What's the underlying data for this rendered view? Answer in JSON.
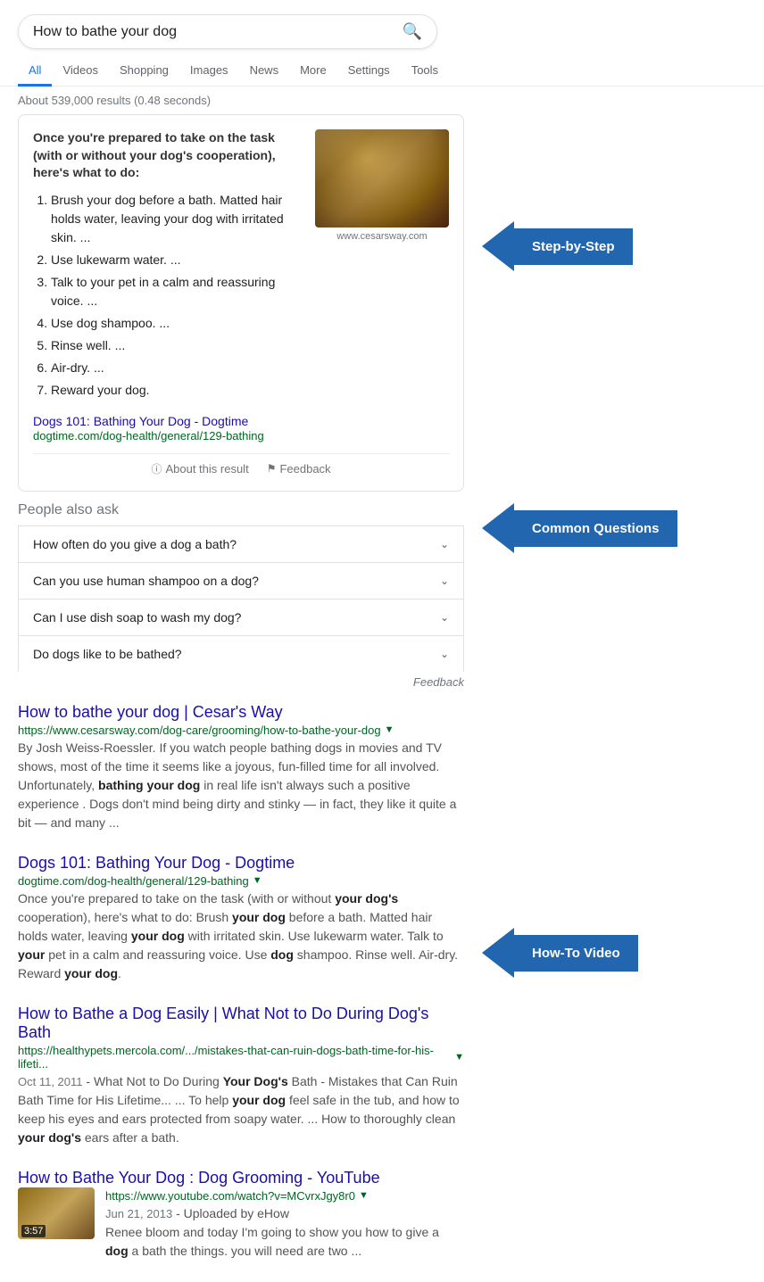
{
  "search": {
    "query": "How to bathe your dog",
    "placeholder": "How to bathe your dog",
    "results_meta": "About 539,000 results (0.48 seconds)"
  },
  "nav": {
    "tabs": [
      {
        "label": "All",
        "active": true
      },
      {
        "label": "Videos",
        "active": false
      },
      {
        "label": "Shopping",
        "active": false
      },
      {
        "label": "Images",
        "active": false
      },
      {
        "label": "News",
        "active": false
      },
      {
        "label": "More",
        "active": false
      },
      {
        "label": "Settings",
        "active": false
      },
      {
        "label": "Tools",
        "active": false
      }
    ]
  },
  "featured_snippet": {
    "title": "Once you're prepared to take on the task (with or without your dog's cooperation), here's what to do:",
    "steps": [
      "Brush your dog before a bath. Matted hair holds water, leaving your dog with irritated skin. ...",
      "Use lukewarm water. ...",
      "Talk to your pet in a calm and reassuring voice. ...",
      "Use dog shampoo. ...",
      "Rinse well. ...",
      "Air-dry. ...",
      "Reward your dog."
    ],
    "image_caption": "www.cesarsway.com",
    "source_title": "Dogs 101: Bathing Your Dog - Dogtime",
    "source_url": "dogtime.com/dog-health/general/129-bathing",
    "about_label": "About this result",
    "feedback_label": "Feedback"
  },
  "paa": {
    "title": "People also ask",
    "questions": [
      "How often do you give a dog a bath?",
      "Can you use human shampoo on a dog?",
      "Can I use dish soap to wash my dog?",
      "Do dogs like to be bathed?"
    ],
    "feedback_label": "Feedback"
  },
  "results": [
    {
      "title": "How to bathe your dog | Cesar's Way",
      "url": "https://www.cesarsway.com/dog-care/grooming/how-to-bathe-your-dog",
      "url_display": "https://www.cesarsway.com/dog-care/grooming/how-to-bathe-your-dog",
      "snippet": "By Josh Weiss-Roessler. If you watch people bathing dogs in movies and TV shows, most of the time it seems like a joyous, fun-filled time for all involved. Unfortunately, bathing your dog in real life isn't always such a positive experience . Dogs don't mind being dirty and stinky — in fact, they like it quite a bit — and many ...",
      "snippet_bold": [
        "bathing your dog"
      ]
    },
    {
      "title": "Dogs 101: Bathing Your Dog - Dogtime",
      "url": "dogtime.com/dog-health/general/129-bathing",
      "url_display": "dogtime.com/dog-health/general/129-bathing",
      "snippet": "Once you're prepared to take on the task (with or without your dog's cooperation), here's what to do: Brush your dog before a bath. Matted hair holds water, leaving your dog with irritated skin. Use lukewarm water. Talk to your pet in a calm and reassuring voice. Use dog shampoo. Rinse well. Air-dry. Reward your dog.",
      "snippet_bold": [
        "your dog's",
        "your dog",
        "your",
        "dog",
        "your dog"
      ]
    },
    {
      "title": "How to Bathe a Dog Easily | What Not to Do During Dog's Bath",
      "url": "https://healthypets.mercola.com/.../mistakes-that-can-ruin-dogs-bath-time-for-his-lifeti...",
      "url_display": "https://healthypets.mercola.com/.../mistakes-that-can-ruin-dogs-bath-time-for-his-lifeti...",
      "date": "Oct 11, 2011",
      "snippet": "What Not to Do During Your Dog's Bath - Mistakes that Can Ruin Bath Time for His Lifetime... ... To help your dog feel safe in the tub, and how to keep his eyes and ears protected from soapy water. ... How to thoroughly clean your dog's ears after a bath.",
      "snippet_bold": [
        "Your Dog's",
        "your dog",
        "your dog's"
      ]
    },
    {
      "title": "How to Bathe Your Dog : Dog Grooming - YouTube",
      "url": "https://www.youtube.com/watch?v=MCvrxJgy8r0",
      "url_display": "https://www.youtube.com/watch?v=MCvrxJgy8r0",
      "is_video": true,
      "video_date": "Jun 21, 2013",
      "video_uploader": "eHow",
      "video_duration": "3:57",
      "snippet": "Renee bloom and today I'm going to show you how to give a dog a bath the things. you will need are two ...",
      "snippet_bold": [
        "dog"
      ]
    }
  ],
  "annotations": [
    {
      "label": "Step-by-Step"
    },
    {
      "label": "Common Questions"
    },
    {
      "label": "How-To Video"
    }
  ]
}
